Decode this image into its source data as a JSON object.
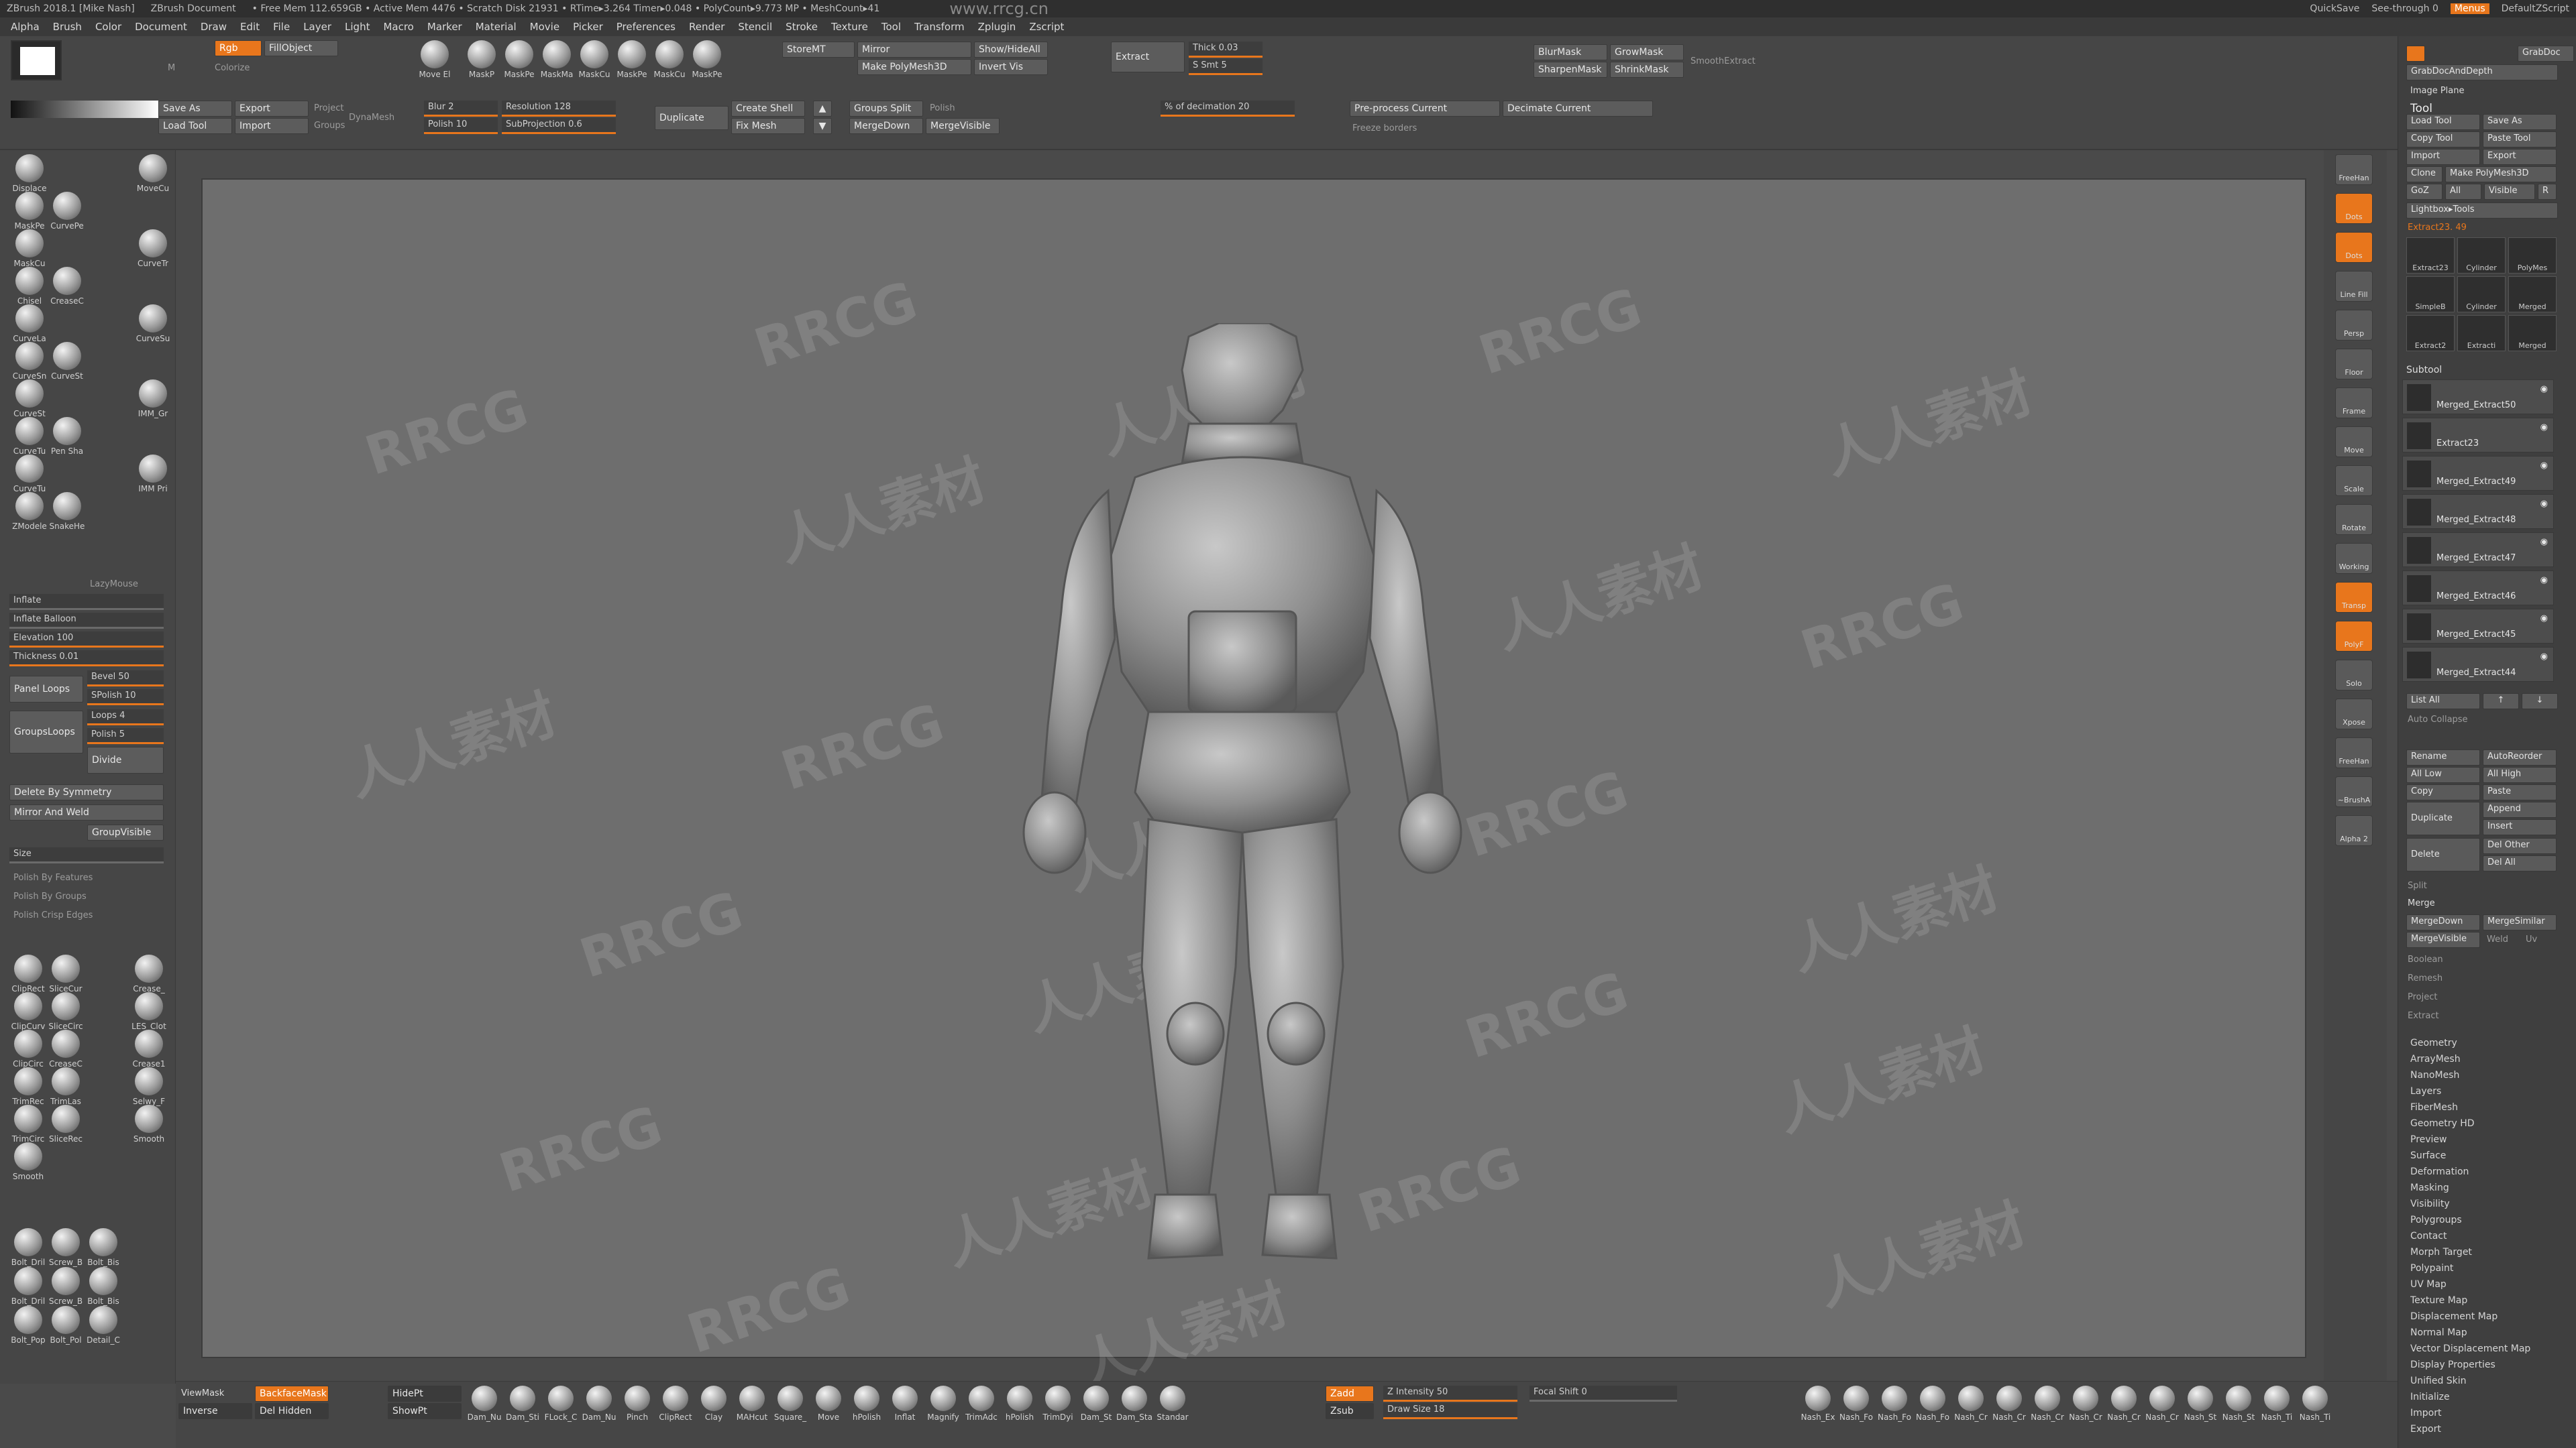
{
  "titlebar": {
    "app": "ZBrush 2018.1 [Mike Nash]",
    "doc": "ZBrush Document",
    "stats": "• Free Mem 112.659GB • Active Mem 4476 • Scratch Disk 21931 • RTime▸3.264 Timer▸0.048 • PolyCount▸9.773 MP • MeshCount▸41",
    "watermark_url": "www.rrcg.cn",
    "quicksave": "QuickSave",
    "seethrough": "See-through 0",
    "menus": "Menus",
    "defaultzscript": "DefaultZScript"
  },
  "menubar": [
    "Alpha",
    "Brush",
    "Color",
    "Document",
    "Draw",
    "Edit",
    "File",
    "Layer",
    "Light",
    "Macro",
    "Marker",
    "Material",
    "Movie",
    "Picker",
    "Preferences",
    "Render",
    "Stencil",
    "Stroke",
    "Texture",
    "Tool",
    "Transform",
    "Zplugin",
    "Zscript"
  ],
  "top": {
    "rgb": "Rgb",
    "m": "M",
    "fillobject": "FillObject",
    "colorize": "Colorize",
    "moveel": "Move El",
    "tools_icons": [
      "MaskP",
      "MaskPe",
      "MaskMa",
      "MaskCu",
      "MaskPe",
      "MaskCu",
      "MaskPe"
    ],
    "saveas": "Save As",
    "export": "Export",
    "loadtool": "Load Tool",
    "import": "Import",
    "project": "Project",
    "groups": "Groups",
    "dynamesh": "DynaMesh",
    "blur": "Blur 2",
    "polish": "Polish 10",
    "resolution": "Resolution 128",
    "subprojection": "SubProjection 0.6",
    "duplicate": "Duplicate",
    "createshell": "Create Shell",
    "fixmesh": "Fix Mesh",
    "groupssplit": "Groups Split",
    "polishbtn": "Polish",
    "mergedown": "MergeDown",
    "mergevisible": "MergeVisible",
    "storemt": "StoreMT",
    "mirror": "Mirror",
    "showhideall": "Show/HideAll",
    "makepolymesh": "Make PolyMesh3D",
    "invertvis": "Invert Vis",
    "extract": "Extract",
    "thick": "Thick 0.03",
    "ssmt": "S Smt 5",
    "blurmask": "BlurMask",
    "growmask": "GrowMask",
    "sharpenmask": "SharpenMask",
    "shrinkmask": "ShrinkMask",
    "smoothextract": "SmoothExtract",
    "decimation": "% of decimation 20",
    "preprocess": "Pre-process Current",
    "decimate": "Decimate Current",
    "freeze": "Freeze borders"
  },
  "left": {
    "brushes1": [
      "Displace",
      "MoveCu",
      "MaskPe",
      "CurvePe",
      "MaskCu",
      "CurveTr",
      "Chisel",
      "CreaseC",
      "CurveLa",
      "CurveSu",
      "CurveSn",
      "CurveSt",
      "CurveSt",
      "IMM_Gr",
      "CurveTu",
      "Pen Sha",
      "CurveTu",
      "IMM Pri",
      "ZModele",
      "SnakeHe"
    ],
    "lazymouse": "LazyMouse",
    "inflate": "Inflate",
    "inflateballoon": "Inflate Balloon",
    "elevation": "Elevation 100",
    "thickness": "Thickness 0.01",
    "panelloops": "Panel Loops",
    "bevel": "Bevel 50",
    "spolish": "SPolish 10",
    "groupsloops": "GroupsLoops",
    "loops": "Loops 4",
    "polish": "Polish 5",
    "divide": "Divide",
    "deletebysymmetry": "Delete By Symmetry",
    "mirrorandweld": "Mirror And Weld",
    "groupvisible": "GroupVisible",
    "size": "Size",
    "polishbyfeatures": "Polish By Features",
    "polishbygroups": "Polish By Groups",
    "polishcrisp": "Polish Crisp Edges",
    "brushes2": [
      "ClipRect",
      "SliceCur",
      "Crease_",
      "ClipCurv",
      "SliceCirc",
      "LES_Clot",
      "ClipCirc",
      "CreaseC",
      "Crease1",
      "TrimRec",
      "TrimLas",
      "Selwy_F",
      "TrimCirc",
      "SliceRec",
      "Smooth",
      "Smooth"
    ],
    "brushes3": [
      "Bolt_Dril",
      "Screw_B",
      "Bolt_Bis",
      "Bolt_Dril",
      "Screw_B",
      "Bolt_Bis",
      "Bolt_Pop",
      "Bolt_Pol",
      "Detail_C"
    ]
  },
  "right_shelf": [
    "FreeHan",
    "Dots",
    "Dots",
    "Line Fill",
    "Persp",
    "Floor",
    "Frame",
    "Move",
    "Scale",
    "Rotate",
    "Working",
    "Transp",
    "PolyF",
    "Solo",
    "Xpose",
    "FreeHan",
    "~BrushA",
    "Alpha 2"
  ],
  "right": {
    "lightbox": "Lightbox",
    "grabdoc": "GrabDoc",
    "grabdocdepth": "GrabDocAndDepth",
    "imageplane": "Image Plane",
    "tool": "Tool",
    "loadtool": "Load Tool",
    "saveas": "Save As",
    "copytool": "Copy Tool",
    "pastetool": "Paste Tool",
    "import": "Import",
    "export": "Export",
    "clone": "Clone",
    "makepolymesh": "Make PolyMesh3D",
    "goz": "GoZ",
    "all": "All",
    "visible": "Visible",
    "r": "R",
    "lightboxtools": "Lightbox▸Tools",
    "extractlabel": "Extract23. 49",
    "thumbs": [
      "Extract23",
      "Cylinder",
      "PolyMes",
      "SimpleB",
      "Cylinder",
      "Merged",
      "Extract2",
      "Extracti",
      "Merged"
    ],
    "subtool": "Subtool",
    "subtools": [
      "Merged_Extract50",
      "Extract23",
      "Merged_Extract49",
      "Merged_Extract48",
      "Merged_Extract47",
      "Merged_Extract46",
      "Merged_Extract45",
      "Merged_Extract44"
    ],
    "listall": "List All",
    "autocollapse": "Auto Collapse",
    "rename": "Rename",
    "autoreorder": "AutoReorder",
    "alllow": "All Low",
    "allhigh": "All High",
    "copy": "Copy",
    "paste": "Paste",
    "duplicate": "Duplicate",
    "append": "Append",
    "insert": "Insert",
    "delete": "Delete",
    "delother": "Del Other",
    "delall": "Del All",
    "split": "Split",
    "merge": "Merge",
    "mergedown": "MergeDown",
    "mergesimilar": "MergeSimilar",
    "mergevisible": "MergeVisible",
    "weld": "Weld",
    "uv": "Uv",
    "boolean": "Boolean",
    "remesh": "Remesh",
    "project": "Project",
    "extract": "Extract",
    "sections": [
      "Geometry",
      "ArrayMesh",
      "NanoMesh",
      "Layers",
      "FiberMesh",
      "Geometry HD",
      "Preview",
      "Surface",
      "Deformation",
      "Masking",
      "Visibility",
      "Polygroups",
      "Contact",
      "Morph Target",
      "Polypaint",
      "UV Map",
      "Texture Map",
      "Displacement Map",
      "Normal Map",
      "Vector Displacement Map",
      "Display Properties",
      "Unified Skin",
      "Initialize",
      "Import",
      "Export"
    ]
  },
  "bottom": {
    "viewmask": "ViewMask",
    "backfacemask": "BackfaceMask",
    "inverse": "Inverse",
    "delhidden": "Del Hidden",
    "hidept": "HidePt",
    "showpt": "ShowPt",
    "brushes": [
      "Dam_Nu",
      "Dam_Sti",
      "FLock_C",
      "Dam_Nu",
      "Pinch",
      "ClipRect",
      "Clay",
      "MAHcut",
      "Square_",
      "Move",
      "hPolish",
      "Inflat",
      "Magnify",
      "TrimAdc",
      "hPolish",
      "TrimDyi",
      "Dam_St",
      "Dam_Sta",
      "Standar"
    ],
    "zadd": "Zadd",
    "zsub": "Zsub",
    "zintensity": "Z Intensity 50",
    "drawsize": "Draw Size 18",
    "focalshift": "Focal Shift 0",
    "nash": [
      "Nash_Ex",
      "Nash_Fo",
      "Nash_Fo",
      "Nash_Fo",
      "Nash_Cr",
      "Nash_Cr",
      "Nash_Cr",
      "Nash_Cr",
      "Nash_Cr",
      "Nash_Cr",
      "Nash_St",
      "Nash_St",
      "Nash_Ti",
      "Nash_Ti"
    ]
  },
  "watermarks": [
    "RRCG",
    "人人素材"
  ],
  "colors": {
    "accent": "#e8761c",
    "viewport": "#6e6e6e",
    "panel": "#464646"
  }
}
